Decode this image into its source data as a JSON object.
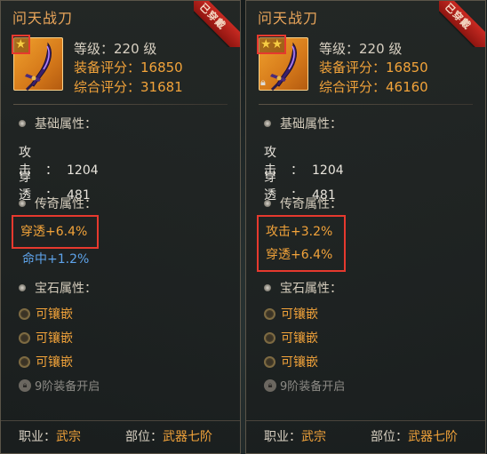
{
  "panels": [
    {
      "title": "问天战刀",
      "badge": "已穿戴",
      "stars": 1,
      "locked": false,
      "level": "等级：220 级",
      "equip_score": "装备评分：16850",
      "total_score": "综合评分：31681",
      "base_title": "基础属性：",
      "attack_label": "攻击：",
      "attack_value": "1204",
      "pierce_label": "穿透：",
      "pierce_value": "481",
      "legend_title": "传奇属性：",
      "legend_boxed": [
        "穿透+6.4%"
      ],
      "legend_extra": "命中+1.2%",
      "gem_title": "宝石属性：",
      "gems": [
        "可镶嵌",
        "可镶嵌",
        "可镶嵌"
      ],
      "locked_slot": "9阶装备开启",
      "job_label": "职业：",
      "job_value": "武宗",
      "part_label": "部位：",
      "part_value": "武器七阶"
    },
    {
      "title": "问天战刀",
      "badge": "已穿戴",
      "stars": 2,
      "locked": true,
      "level": "等级：220 级",
      "equip_score": "装备评分：16850",
      "total_score": "综合评分：46160",
      "base_title": "基础属性：",
      "attack_label": "攻击：",
      "attack_value": "1204",
      "pierce_label": "穿透：",
      "pierce_value": "481",
      "legend_title": "传奇属性：",
      "legend_boxed": [
        "攻击+3.2%",
        "穿透+6.4%"
      ],
      "gem_title": "宝石属性：",
      "gems": [
        "可镶嵌",
        "可镶嵌",
        "可镶嵌"
      ],
      "locked_slot": "9阶装备开启",
      "job_label": "职业：",
      "job_value": "武宗",
      "part_label": "部位：",
      "part_value": "武器七阶"
    }
  ],
  "colors": {
    "accent": "#f2a33a",
    "highlight_box": "#e6392e",
    "secondary_stat": "#5ea3ea",
    "badge": "#c82a22"
  },
  "icons": {
    "star": "star-icon",
    "weapon": "sword-icon",
    "lock": "lock-icon",
    "gem": "gem-socket-icon"
  }
}
